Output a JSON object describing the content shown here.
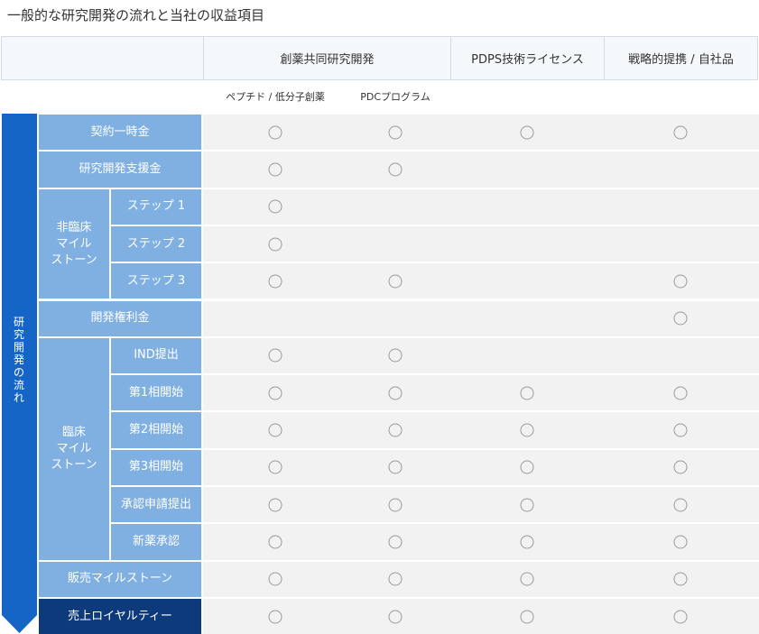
{
  "title": "一般的な研究開発の流れと当社の収益項目",
  "headers": {
    "col1": "創薬共同研究開発",
    "col2": "PDPS技術ライセンス",
    "col3": "戦略的提携 / 自社品"
  },
  "subheaders": {
    "sub1": "ペプチド / 低分子創薬",
    "sub2": "PDCプログラム"
  },
  "arrow_label": "研究開発の流れ",
  "groups": {
    "nonclinical": "非臨床\nマイル\nストーン",
    "clinical": "臨床\nマイル\nストーン"
  },
  "rows": [
    {
      "label": "契約一時金",
      "marks": [
        true,
        true,
        true,
        true
      ]
    },
    {
      "label": "研究開発支援金",
      "marks": [
        true,
        true,
        false,
        false
      ]
    },
    {
      "label": "ステップ 1",
      "marks": [
        true,
        false,
        false,
        false
      ]
    },
    {
      "label": "ステップ 2",
      "marks": [
        true,
        false,
        false,
        false
      ]
    },
    {
      "label": "ステップ 3",
      "marks": [
        true,
        true,
        false,
        true
      ]
    },
    {
      "label": "開発権利金",
      "marks": [
        false,
        false,
        false,
        true
      ]
    },
    {
      "label": "IND提出",
      "marks": [
        true,
        true,
        false,
        false
      ]
    },
    {
      "label": "第1相開始",
      "marks": [
        true,
        true,
        true,
        true
      ]
    },
    {
      "label": "第2相開始",
      "marks": [
        true,
        true,
        true,
        true
      ]
    },
    {
      "label": "第3相開始",
      "marks": [
        true,
        true,
        true,
        true
      ]
    },
    {
      "label": "承認申請提出",
      "marks": [
        true,
        true,
        true,
        true
      ]
    },
    {
      "label": "新薬承認",
      "marks": [
        true,
        true,
        true,
        true
      ]
    },
    {
      "label": "販売マイルストーン",
      "marks": [
        true,
        true,
        true,
        true
      ]
    },
    {
      "label": "売上ロイヤルティー",
      "marks": [
        true,
        true,
        true,
        true
      ]
    }
  ],
  "colors": {
    "label_bg": "#7fb0e1",
    "label_dark": "#0d3a7a",
    "arrow": "#1565c7",
    "row_bg": "#f2f2f2",
    "header_bg": "#f4f7fb"
  }
}
